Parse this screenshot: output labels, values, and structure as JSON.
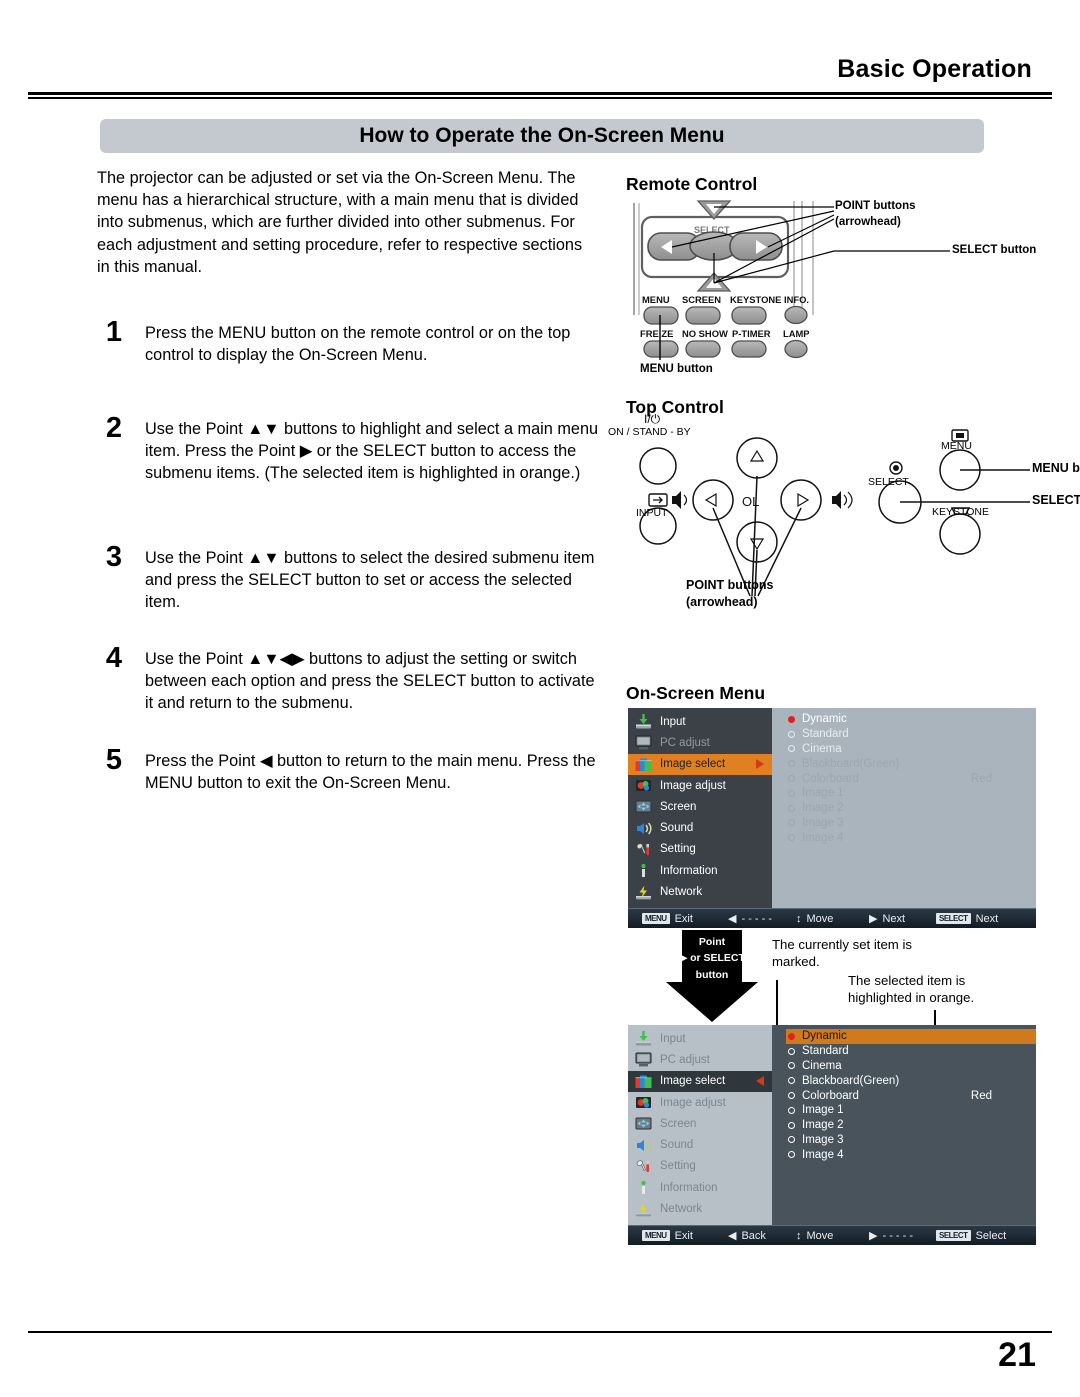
{
  "header": {
    "section_title": "Basic Operation"
  },
  "banner": {
    "title": "How to Operate the On-Screen Menu"
  },
  "intro": {
    "paragraph": "The projector can be adjusted or set via the On-Screen Menu. The menu has a hierarchical structure, with a main menu that is divided into submenus, which are further divided into other submenus. For each adjustment and setting procedure, refer to respective sections in this manual."
  },
  "steps": [
    {
      "num": "1",
      "text": "Press the MENU button on the remote control or on the top control to display the On-Screen Menu."
    },
    {
      "num": "2",
      "text": "Use the Point ▲▼ buttons to highlight and select a main menu item. Press the Point ▶ or the SELECT button to access the submenu items. (The selected item is highlighted in orange.)"
    },
    {
      "num": "3",
      "text": "Use the Point ▲▼ buttons to select the desired submenu item and press the SELECT button to set or access the selected item."
    },
    {
      "num": "4",
      "text": "Use the Point ▲▼◀▶ buttons to adjust the setting or switch between each option and press the SELECT button to activate it and return to the submenu."
    },
    {
      "num": "5",
      "text": "Press the Point ◀ button to return to the main menu. Press the MENU button to exit the On-Screen Menu."
    }
  ],
  "remote_control": {
    "title": "Remote Control",
    "callouts": {
      "point_buttons": "POINT buttons",
      "point_buttons_sub": "(arrowhead)",
      "select_button": "SELECT button",
      "menu_button": "MENU button"
    },
    "face_select_text": "SELECT",
    "button_row_1": [
      "MENU",
      "SCREEN",
      "KEYSTONE",
      "INFO."
    ],
    "button_row_2": [
      "FREEZE",
      "NO SHOW",
      "P-TIMER",
      "LAMP"
    ]
  },
  "top_control": {
    "title": "Top Control",
    "power_symbol": "I/⏻",
    "power_label": "ON / STAND - BY",
    "input_label": "INPUT",
    "volume_label": "VOL",
    "menu_label": "MENU",
    "select_label": "SELECT",
    "keystone_label": "KEYSTONE",
    "callouts": {
      "menu_button": "MENU button",
      "select_button": "SELECT button",
      "point_buttons": "POINT buttons",
      "point_buttons_sub": "(arrowhead)"
    }
  },
  "on_screen_menu": {
    "title": "On-Screen Menu",
    "main_menu": [
      {
        "label": "Input",
        "icon": "input-icon"
      },
      {
        "label": "PC adjust",
        "icon": "monitor-icon"
      },
      {
        "label": "Image select",
        "icon": "image-select-icon"
      },
      {
        "label": "Image adjust",
        "icon": "image-adjust-icon"
      },
      {
        "label": "Screen",
        "icon": "screen-icon"
      },
      {
        "label": "Sound",
        "icon": "speaker-icon"
      },
      {
        "label": "Setting",
        "icon": "tools-icon"
      },
      {
        "label": "Information",
        "icon": "info-icon"
      },
      {
        "label": "Network",
        "icon": "network-icon"
      }
    ],
    "selected_main_index": 2,
    "submenu": [
      {
        "label": "Dynamic",
        "marked": true
      },
      {
        "label": "Standard",
        "marked": false
      },
      {
        "label": "Cinema",
        "marked": false
      },
      {
        "label": "Blackboard(Green)",
        "marked": false
      },
      {
        "label": "Colorboard",
        "marked": false,
        "value": "Red"
      },
      {
        "label": "Image 1",
        "marked": false
      },
      {
        "label": "Image 2",
        "marked": false
      },
      {
        "label": "Image 3",
        "marked": false
      },
      {
        "label": "Image 4",
        "marked": false
      }
    ],
    "selected_sub_index": 0,
    "footer_top": {
      "exit_key": "MENU",
      "exit": "Exit",
      "back_glyph": "◀",
      "back": "- - - - -",
      "move_glyph": "↕",
      "move": "Move",
      "next_glyph": "▶",
      "next": "Next",
      "select_key": "SELECT",
      "select": "Next"
    },
    "footer_bottom": {
      "exit_key": "MENU",
      "exit": "Exit",
      "back_glyph": "◀",
      "back": "Back",
      "move_glyph": "↕",
      "move": "Move",
      "next_glyph": "▶",
      "next": "- - - - -",
      "select_key": "SELECT",
      "select": "Select"
    }
  },
  "callouts": {
    "point_or_select_line1": "Point",
    "point_or_select_line2": "▶ or SELECT",
    "point_or_select_line3": "button",
    "marked_note": "The currently set item is marked.",
    "orange_note": "The selected item is highlighted in orange."
  },
  "footer": {
    "page_number": "21"
  },
  "colors": {
    "banner_bg": "#c3c9ce",
    "orange_highlight": "#e08020",
    "osd_dark_panel": "#3b4147",
    "osd_light_panel": "#b7c0c7",
    "red_marker": "#e02020"
  }
}
